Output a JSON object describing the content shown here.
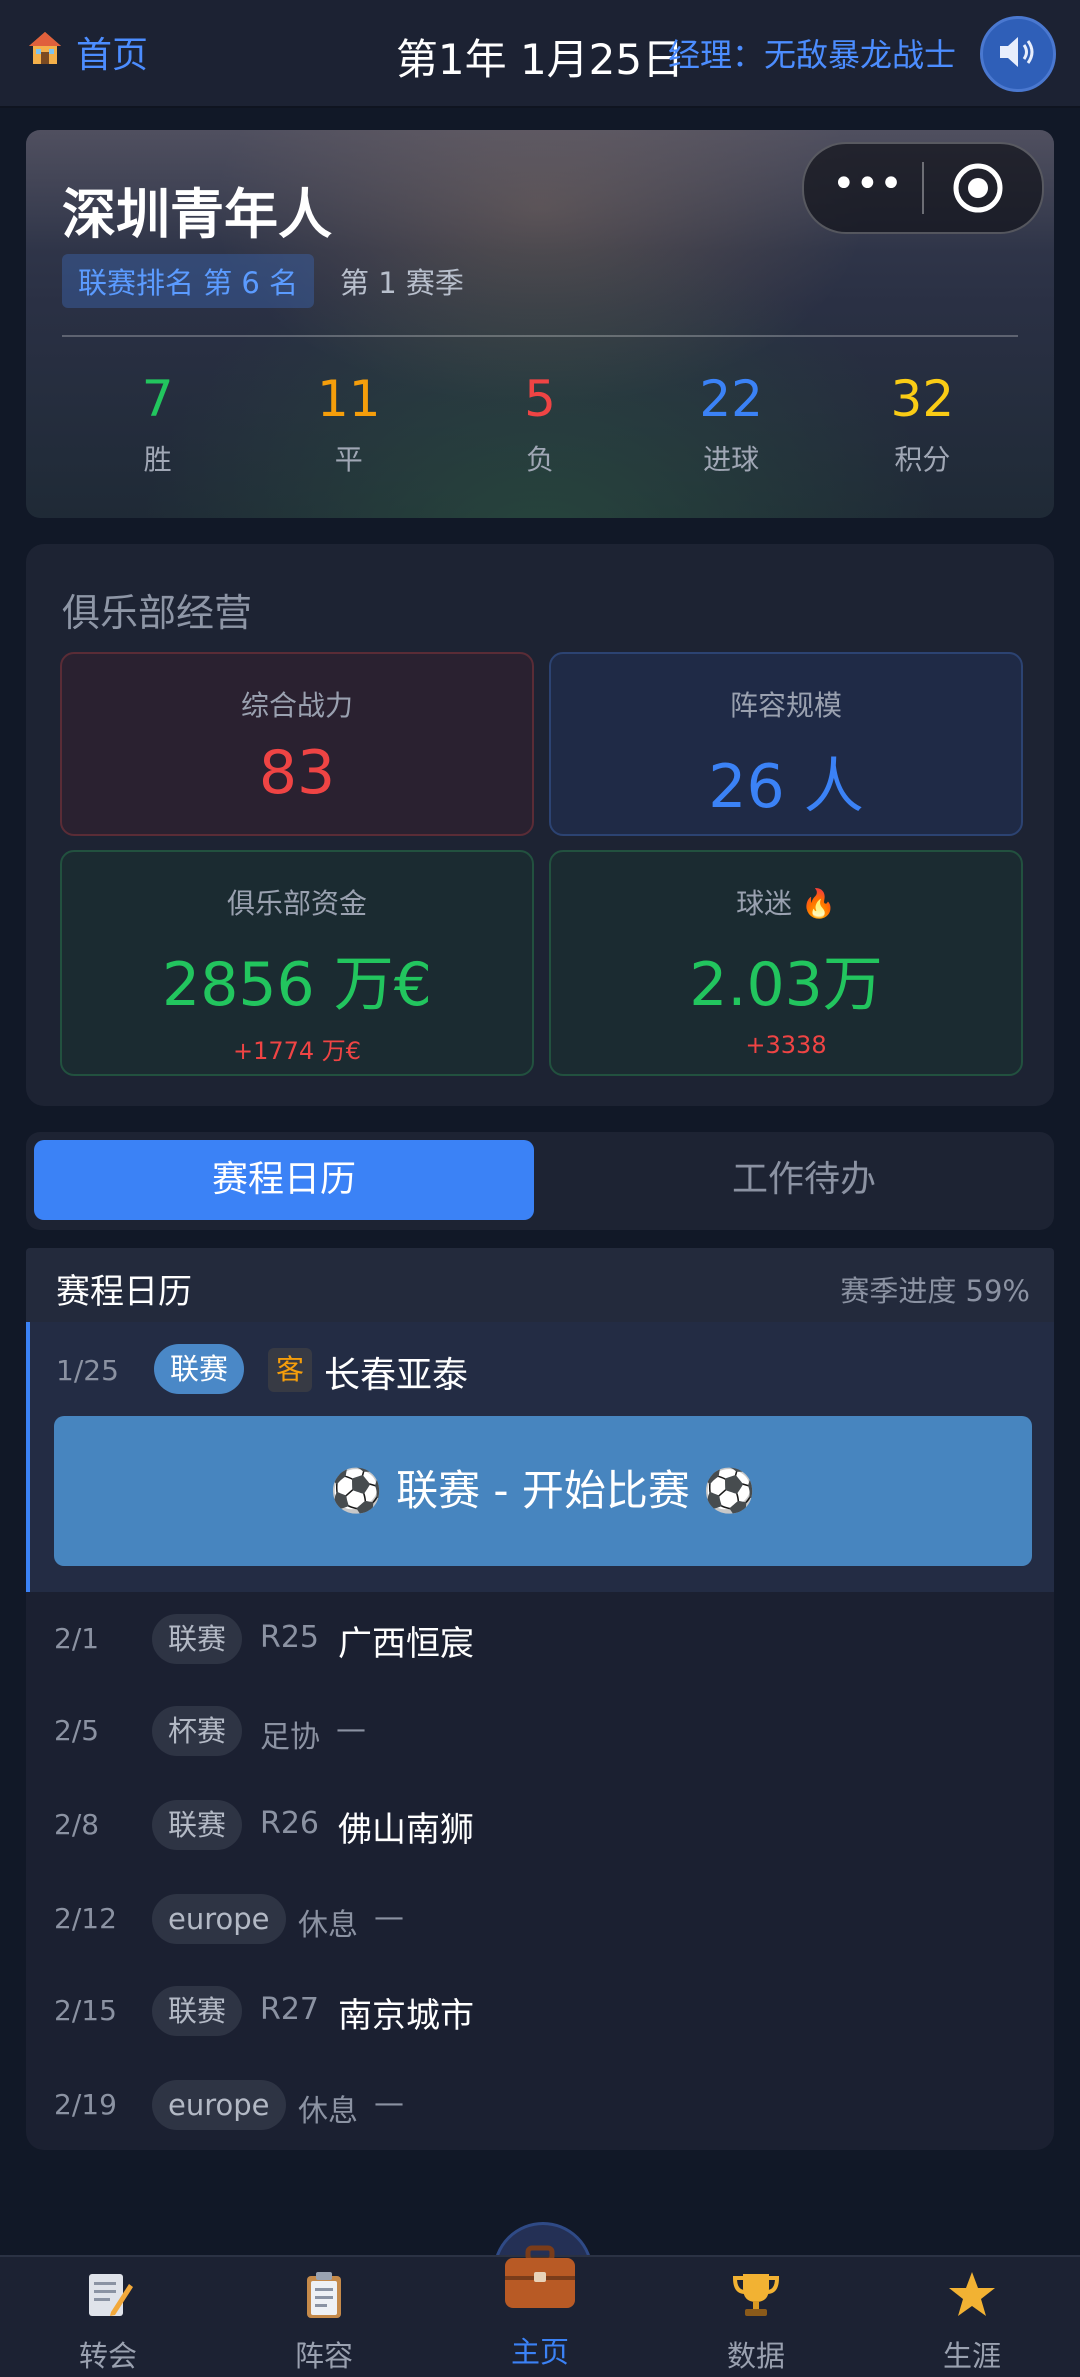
{
  "topbar": {
    "home_label": "首页",
    "date": "第1年 1月25日",
    "manager": "经理：无敌暴龙战士"
  },
  "hero": {
    "club_name": "深圳青年人",
    "rank": "联赛排名 第 6 名",
    "season": "第 1 赛季",
    "stats": [
      {
        "value": "7",
        "label": "胜",
        "color": "#22c55e"
      },
      {
        "value": "11",
        "label": "平",
        "color": "#f59e0b"
      },
      {
        "value": "5",
        "label": "负",
        "color": "#ef4444"
      },
      {
        "value": "22",
        "label": "进球",
        "color": "#3b82f6"
      },
      {
        "value": "32",
        "label": "积分",
        "color": "#facc15"
      }
    ]
  },
  "club": {
    "title": "俱乐部经营",
    "power": {
      "label": "综合战力",
      "value": "83",
      "color": "#ef4444"
    },
    "squad": {
      "label": "阵容规模",
      "value": "26 人",
      "color": "#3b82f6"
    },
    "funds": {
      "label": "俱乐部资金",
      "value": "2856 万€",
      "change": "+1774 万€",
      "color": "#22c55e"
    },
    "fans": {
      "label": "球迷",
      "value": "2.03万",
      "change": "+3338",
      "color": "#22c55e"
    }
  },
  "tabs": {
    "schedule": "赛程日历",
    "todo": "工作待办"
  },
  "schedule": {
    "title": "赛程日历",
    "progress": "赛季进度 59%",
    "current": {
      "date": "1/25",
      "type": "联赛",
      "away": "客",
      "opponent": "长春亚泰",
      "button": "⚽ 联赛 - 开始比赛 ⚽"
    },
    "rows": [
      {
        "date": "2/1",
        "type": "联赛",
        "round": "R25",
        "opponent": "广西恒宸"
      },
      {
        "date": "2/5",
        "type": "杯赛",
        "round": "足协",
        "dash": "—"
      },
      {
        "date": "2/8",
        "type": "联赛",
        "round": "R26",
        "opponent": "佛山南狮"
      },
      {
        "date": "2/12",
        "type": "europe",
        "round": "休息",
        "dash": "—"
      },
      {
        "date": "2/15",
        "type": "联赛",
        "round": "R27",
        "opponent": "南京城市"
      },
      {
        "date": "2/19",
        "type": "europe",
        "round": "休息",
        "dash": "—"
      }
    ]
  },
  "nav": {
    "items": [
      {
        "label": "转会",
        "icon": "memo-pencil-icon"
      },
      {
        "label": "阵容",
        "icon": "clipboard-icon"
      },
      {
        "label": "主页",
        "icon": "briefcase-icon"
      },
      {
        "label": "数据",
        "icon": "trophy-icon"
      },
      {
        "label": "生涯",
        "icon": "star-icon"
      }
    ]
  }
}
